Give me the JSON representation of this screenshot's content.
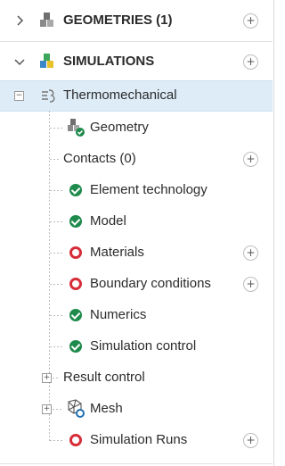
{
  "tree": {
    "geometries": {
      "label": "GEOMETRIES (1)",
      "icon": "cubes-icon"
    },
    "simulations": {
      "label": "SIMULATIONS",
      "icon": "colored-cubes-icon"
    },
    "analysis": {
      "label": "Thermomechanical",
      "icon": "thermo-icon"
    },
    "items": [
      {
        "label": "Geometry"
      },
      {
        "label": "Contacts (0)"
      },
      {
        "label": "Element technology",
        "status": "ok"
      },
      {
        "label": "Model",
        "status": "ok"
      },
      {
        "label": "Materials",
        "status": "error"
      },
      {
        "label": "Boundary conditions",
        "status": "error"
      },
      {
        "label": "Numerics",
        "status": "ok"
      },
      {
        "label": "Simulation control",
        "status": "ok"
      },
      {
        "label": "Result control"
      },
      {
        "label": "Mesh"
      },
      {
        "label": "Simulation Runs",
        "status": "error"
      }
    ]
  },
  "colors": {
    "ok": "#1e8a4c",
    "error": "#d62d39",
    "selected": "#ddecf7"
  }
}
